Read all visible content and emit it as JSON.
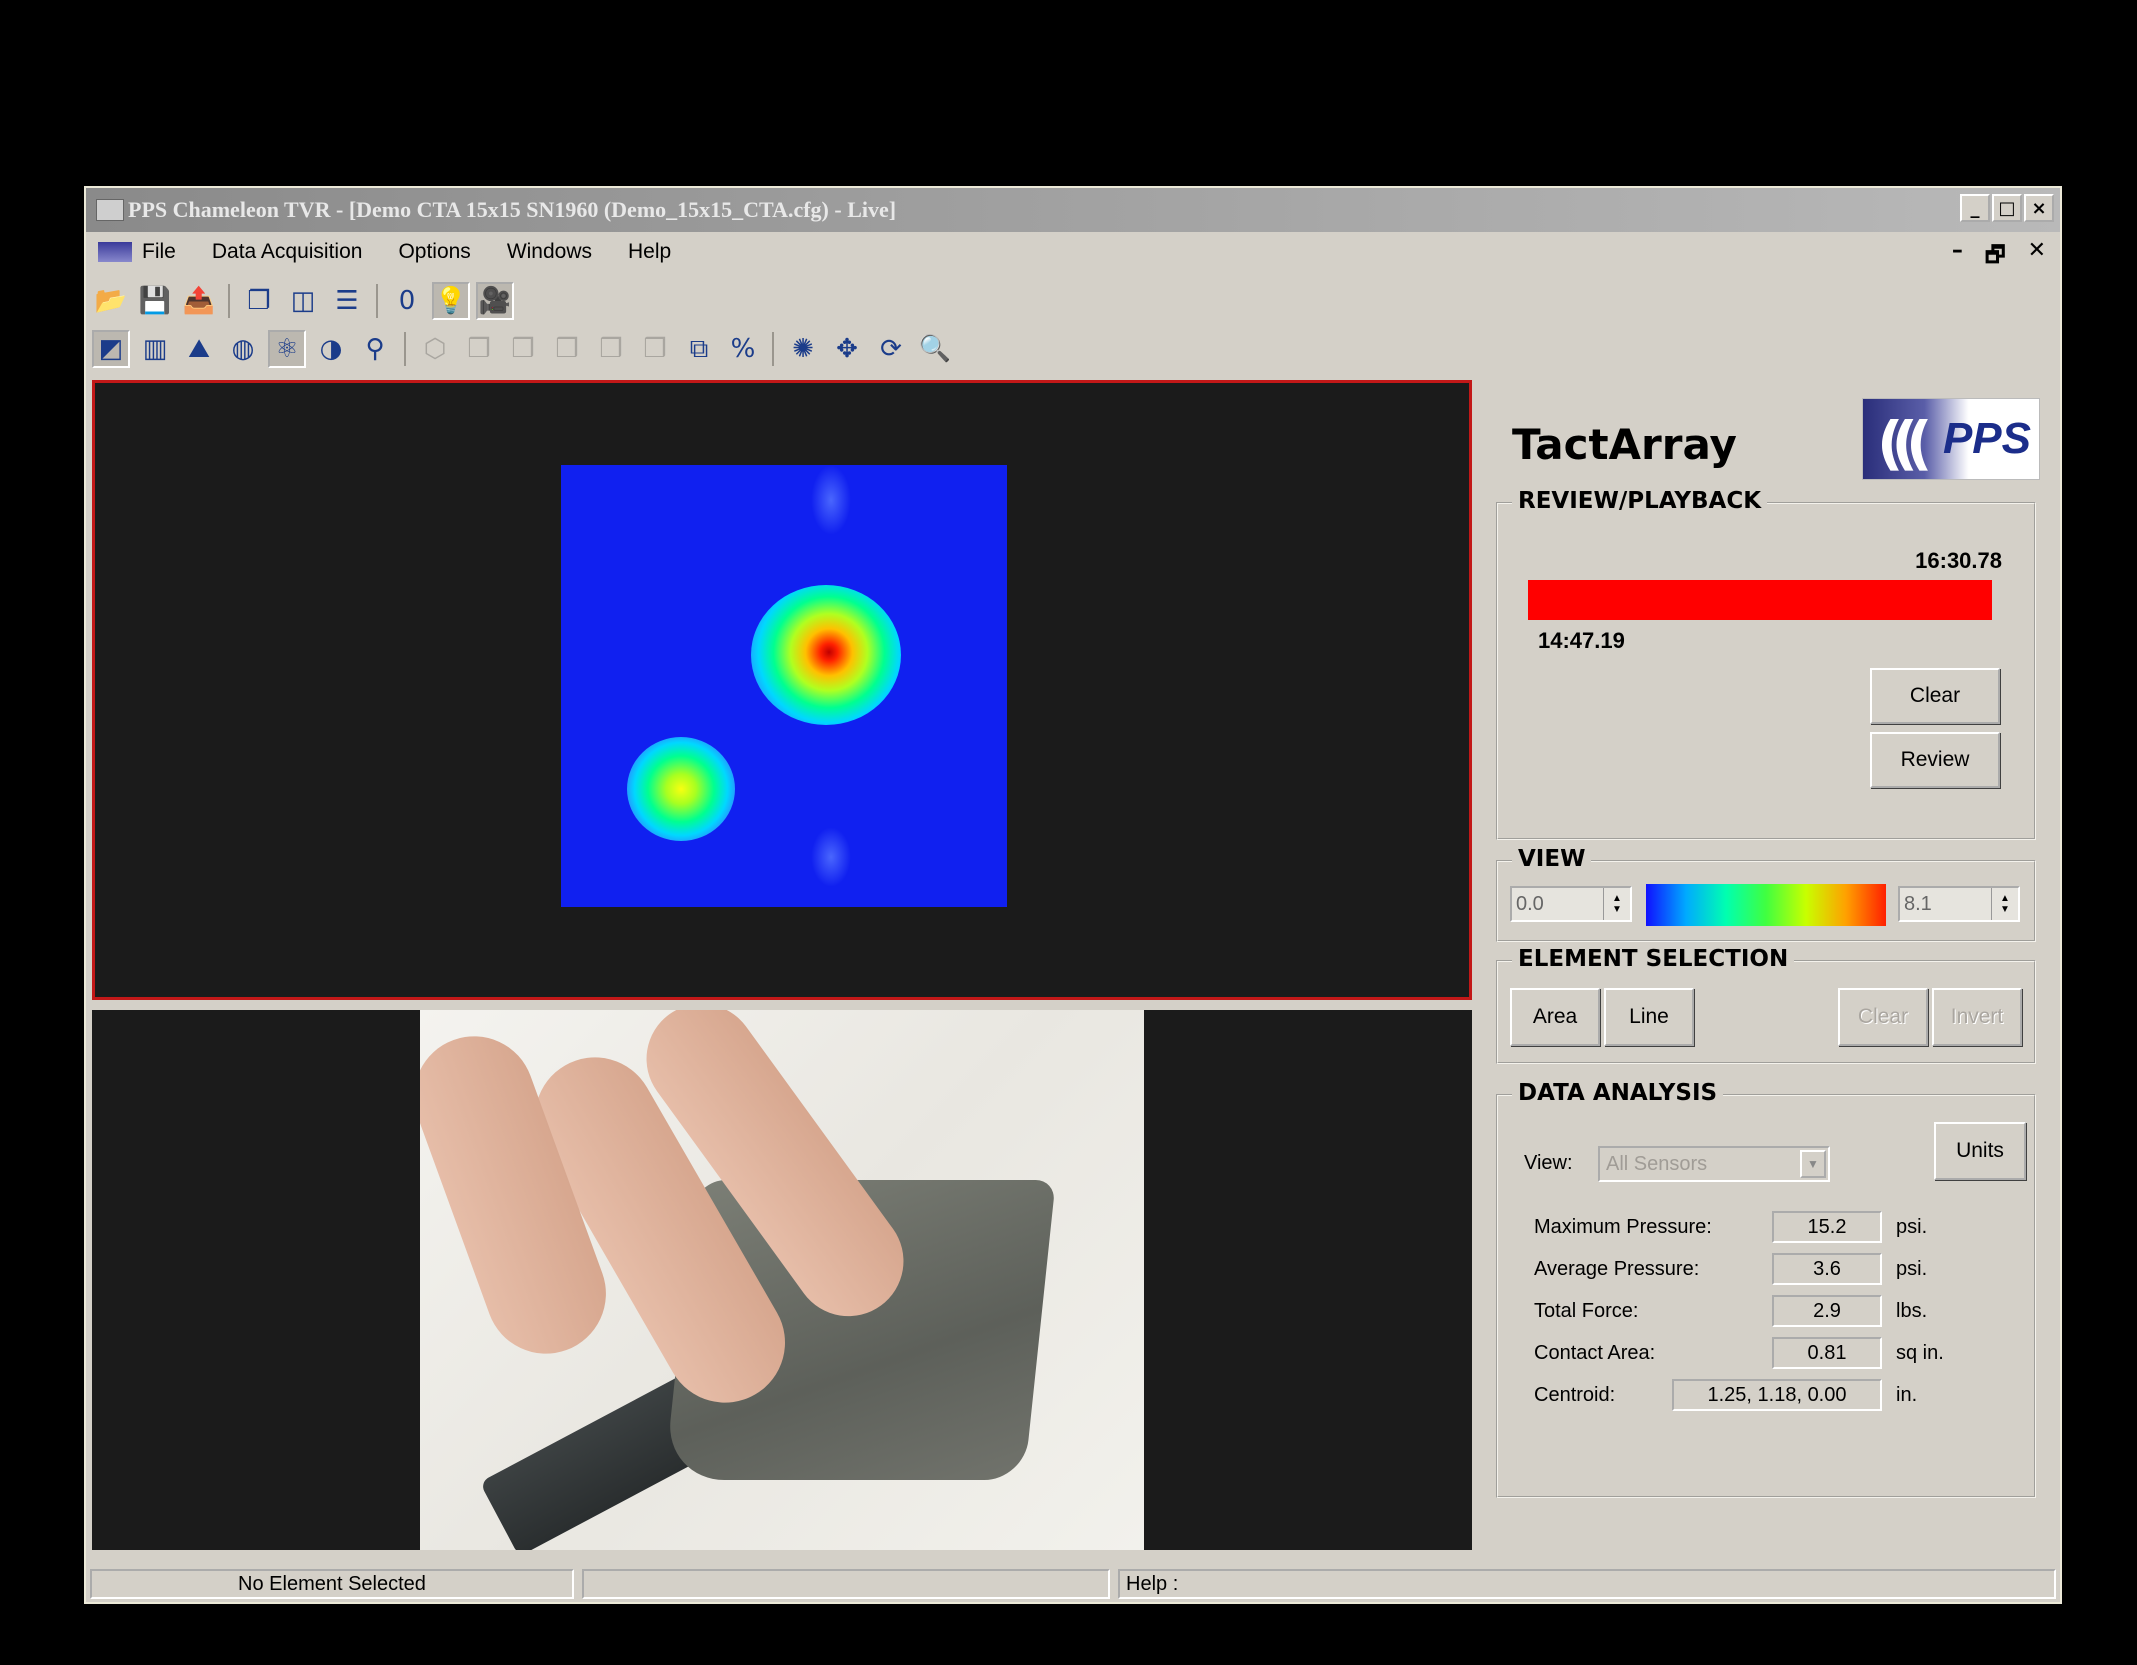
{
  "window": {
    "title": "PPS Chameleon TVR - [Demo CTA 15x15 SN1960 (Demo_15x15_CTA.cfg) - Live]",
    "title_buttons": [
      "_",
      "□",
      "×"
    ],
    "mdi_buttons": [
      "–",
      "🗗",
      "✕"
    ]
  },
  "menu": {
    "items": [
      "File",
      "Data Acquisition",
      "Options",
      "Windows",
      "Help"
    ]
  },
  "toolbar1": {
    "icons": [
      {
        "name": "open-folder-icon",
        "glyph": "📂"
      },
      {
        "name": "save-icon",
        "glyph": "💾"
      },
      {
        "name": "export-icon",
        "glyph": "📤"
      },
      {
        "name": "cascade-windows-icon",
        "glyph": "❐"
      },
      {
        "name": "tile-vertical-icon",
        "glyph": "◫"
      },
      {
        "name": "tile-horizontal-icon",
        "glyph": "☰"
      },
      {
        "name": "zero-icon",
        "glyph": "0"
      },
      {
        "name": "lightbulb-icon",
        "glyph": "💡"
      },
      {
        "name": "camera-icon",
        "glyph": "🎥"
      }
    ]
  },
  "toolbar2": {
    "icons": [
      {
        "name": "color-map-icon",
        "glyph": "◩"
      },
      {
        "name": "bar-chart-icon",
        "glyph": "▥"
      },
      {
        "name": "surface-plot-icon",
        "glyph": "⛰"
      },
      {
        "name": "globe-icon",
        "glyph": "◍"
      },
      {
        "name": "grid-view-icon",
        "glyph": "⚛"
      },
      {
        "name": "centroid-icon",
        "glyph": "◑"
      },
      {
        "name": "probe-icon",
        "glyph": "⚲"
      },
      {
        "name": "view-cube-1-icon",
        "glyph": "⬡"
      },
      {
        "name": "view-cube-2-icon",
        "glyph": "❒"
      },
      {
        "name": "view-cube-3-icon",
        "glyph": "❒"
      },
      {
        "name": "view-cube-4-icon",
        "glyph": "❒"
      },
      {
        "name": "view-cube-5-icon",
        "glyph": "❒"
      },
      {
        "name": "view-cube-6-icon",
        "glyph": "❒"
      },
      {
        "name": "view-cube-7-icon",
        "glyph": "⧉"
      },
      {
        "name": "scale-percent-icon",
        "glyph": "%"
      },
      {
        "name": "light-icon",
        "glyph": "✺"
      },
      {
        "name": "move-icon",
        "glyph": "✥"
      },
      {
        "name": "rotate-icon",
        "glyph": "⟳"
      },
      {
        "name": "zoom-icon",
        "glyph": "🔍"
      }
    ]
  },
  "sidebar": {
    "brand": "TactArray",
    "logo_text": "PPS",
    "review": {
      "label": "REVIEW/PLAYBACK",
      "end_time": "16:30.78",
      "start_time": "14:47.19",
      "progress": 1.0,
      "progress_color": "#ff0000",
      "clear_label": "Clear",
      "review_label": "Review"
    },
    "view": {
      "label": "VIEW",
      "min_value": "0.0",
      "max_value": "8.1"
    },
    "element_selection": {
      "label": "ELEMENT SELECTION",
      "area_label": "Area",
      "line_label": "Line",
      "clear_label": "Clear",
      "invert_label": "Invert"
    },
    "data_analysis": {
      "label": "DATA ANALYSIS",
      "view_label": "View:",
      "view_selected": "All Sensors",
      "units_label": "Units",
      "rows": [
        {
          "label": "Maximum Pressure:",
          "value": "15.2",
          "unit": "psi."
        },
        {
          "label": "Average Pressure:",
          "value": "3.6",
          "unit": "psi."
        },
        {
          "label": "Total Force:",
          "value": "2.9",
          "unit": "lbs."
        },
        {
          "label": "Contact Area:",
          "value": "0.81",
          "unit": "sq in."
        },
        {
          "label": "Centroid:",
          "value": "1.25,  1.18,  0.00",
          "unit": "in."
        }
      ]
    }
  },
  "status": {
    "element": "No Element Selected",
    "middle": "",
    "help": "Help :"
  },
  "colors": {
    "window_bg": "#d4d0c8",
    "heatmap_bg": "#1020f0",
    "pane_border": "#c21818"
  }
}
